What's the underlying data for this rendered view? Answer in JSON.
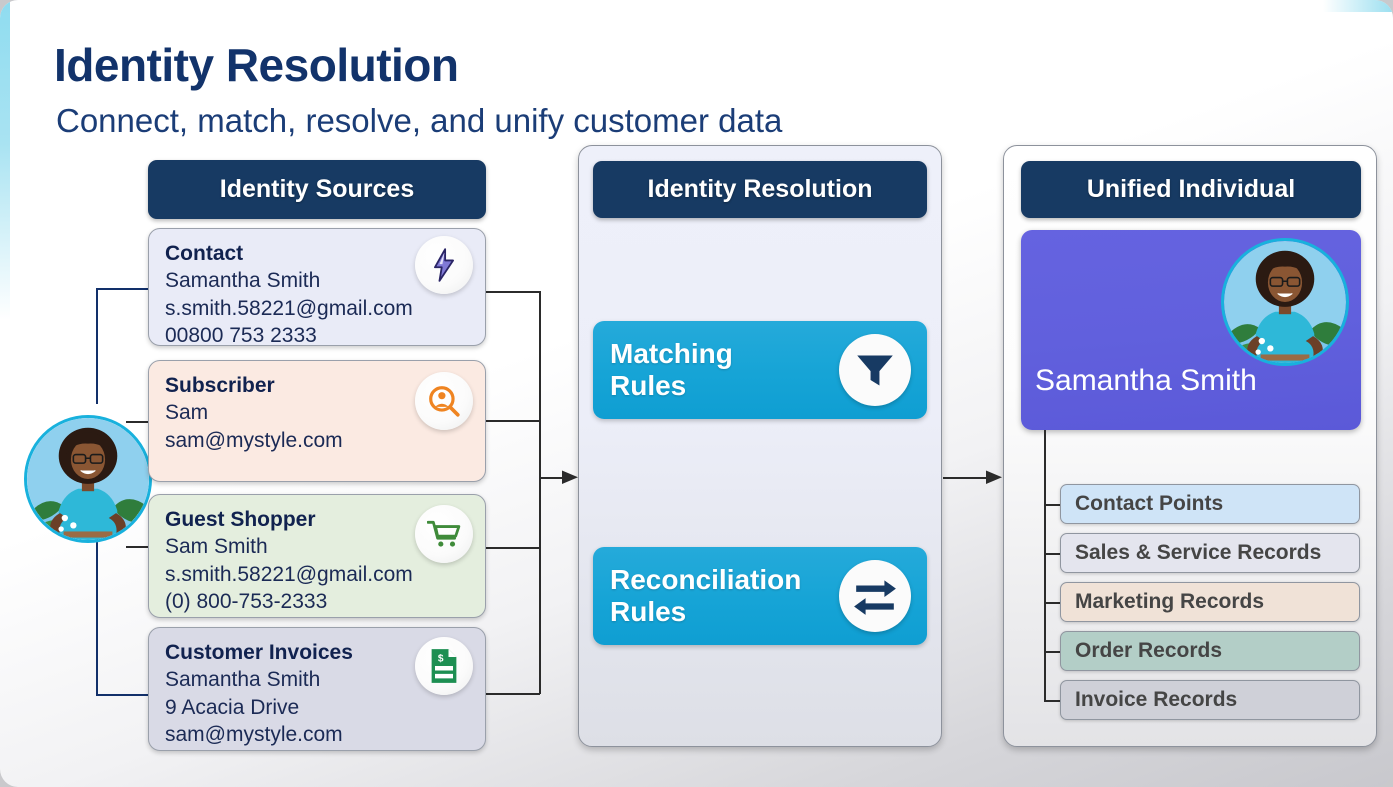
{
  "slide": {
    "title": "Identity Resolution",
    "subtitle": "Connect, match, resolve, and unify customer data"
  },
  "columns": {
    "sources_header": "Identity Sources",
    "resolution_header": "Identity Resolution",
    "unified_header": "Unified Individual"
  },
  "sources": [
    {
      "title": "Contact",
      "lines": [
        "Samantha Smith",
        "s.smith.58221@gmail.com",
        "00800 753 2333"
      ],
      "icon": "lightning-bolt-icon",
      "bg": "#e9ebf7",
      "accent": "#6a62c8"
    },
    {
      "title": "Subscriber",
      "lines": [
        "Sam",
        "sam@mystyle.com"
      ],
      "icon": "person-search-icon",
      "bg": "#fbeae2",
      "accent": "#e8801e"
    },
    {
      "title": "Guest Shopper",
      "lines": [
        "Sam Smith",
        "s.smith.58221@gmail.com",
        "(0) 800-753-2333"
      ],
      "icon": "shopping-cart-icon",
      "bg": "#e4eede",
      "accent": "#3f8b3a"
    },
    {
      "title": "Customer Invoices",
      "lines": [
        "Samantha Smith",
        "9 Acacia Drive",
        "sam@mystyle.com"
      ],
      "icon": "invoice-document-icon",
      "bg": "#d9dae6",
      "accent": "#1d8f52"
    }
  ],
  "rules": [
    {
      "label": "Matching\nRules",
      "icon": "funnel-icon"
    },
    {
      "label": "Reconciliation\nRules",
      "icon": "two-way-arrows-icon"
    }
  ],
  "unified": {
    "person_name": "Samantha Smith",
    "avatar": "customer-avatar",
    "records": [
      {
        "label": "Contact Points",
        "bg": "#cfe4f7"
      },
      {
        "label": "Sales & Service Records",
        "bg": "#e4e5ee"
      },
      {
        "label": "Marketing Records",
        "bg": "#f0e2d7"
      },
      {
        "label": "Order Records",
        "bg": "#b3cec7"
      },
      {
        "label": "Invoice Records",
        "bg": "#cfd0d8"
      }
    ]
  },
  "colors": {
    "header_navy": "#173a63",
    "rule_blue": "#16a4d6",
    "profile_purple": "#6160dd",
    "title_navy": "#12336b",
    "accent_cyan": "#8fdcf0"
  }
}
